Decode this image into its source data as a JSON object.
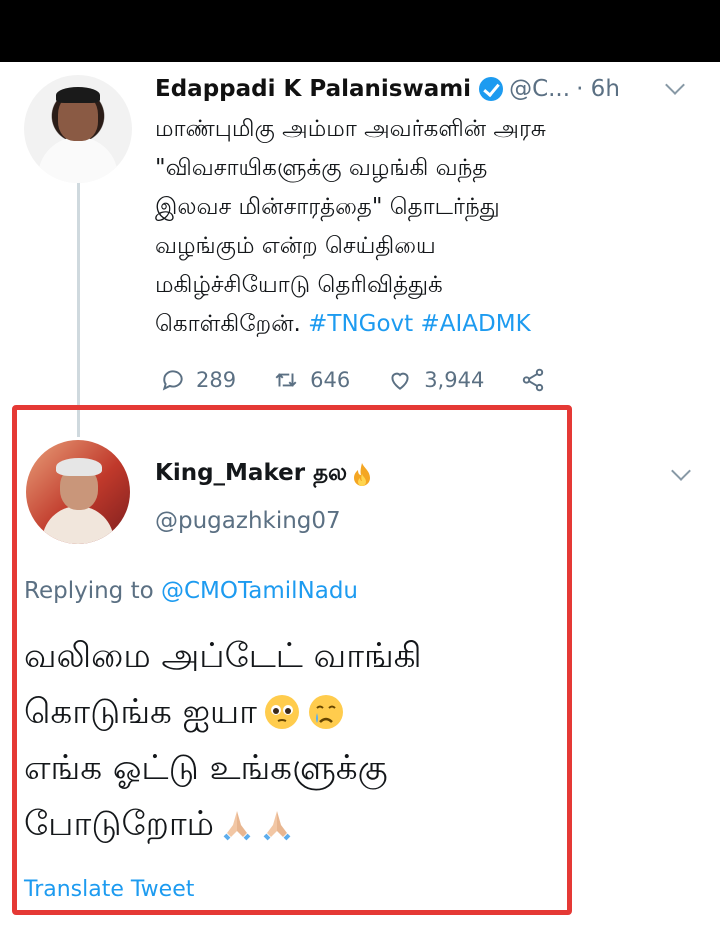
{
  "tweet1": {
    "author_name": "Edappadi K Palaniswami",
    "handle": "@C...",
    "time": "· 6h",
    "body_lines": [
      "மாண்புமிகு அம்மா அவர்களின் அரசு",
      "\"விவசாயிகளுக்கு வழங்கி வந்த",
      "இலவச மின்சாரத்தை\" தொடர்ந்து",
      "வழங்கும் என்ற செய்தியை",
      "மகிழ்ச்சியோடு தெரிவித்துக்",
      "கொள்கிறேன்."
    ],
    "hashtags": [
      "#TNGovt",
      "#AIADMK"
    ],
    "replies": "289",
    "retweets": "646",
    "likes": "3,944"
  },
  "tweet2": {
    "author_name": "King_Maker தல",
    "handle": "@pugazhking07",
    "replying_prefix": "Replying to",
    "replying_to": "@CMOTamilNadu",
    "body_lines": [
      "வலிமை அப்டேட் வாங்கி",
      "கொடுங்க ஐயா",
      "எங்க ஓட்டு உங்களுக்கு",
      "போடுறோம்"
    ],
    "translate_label": "Translate Tweet"
  },
  "colors": {
    "link_blue": "#1d9bf0",
    "muted_gray": "#5b7083",
    "highlight_red": "#e53935"
  },
  "icons": [
    "verified-badge-icon",
    "reply-icon",
    "retweet-icon",
    "like-icon",
    "share-icon",
    "chevron-down-icon",
    "fire-icon",
    "pleading-face-icon",
    "crying-face-icon",
    "folded-hands-icon"
  ]
}
